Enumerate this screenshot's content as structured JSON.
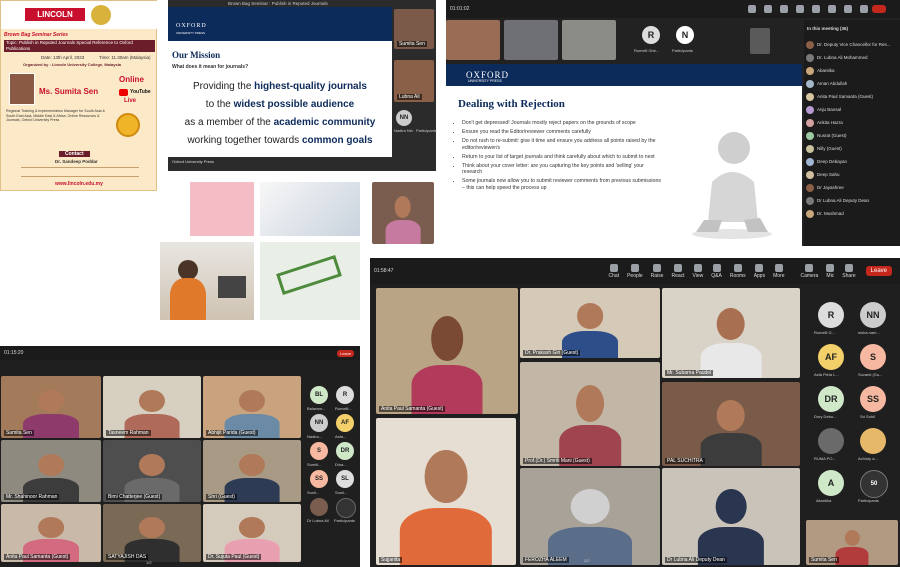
{
  "poster": {
    "logo": "LINCOLN",
    "series": "Brown Bag Seminar Series",
    "topic": "Topic: Publish in Reputed Journals Special Reference to Oxford Publications",
    "date": "Date: 13th April, 2023",
    "time": "Time: 11.30am (Malaysia)",
    "organiser": "Organized by : Lincoln University College, Malaysia",
    "mode": "Online",
    "speaker": "Ms. Sumita Sen",
    "bio": "Regional Training & Implementation Manager for South Asia & South East Asia, Middle East & Africa, Online Resources & Journals, Oxford University Press",
    "youtube": "YouTube",
    "live": "Live",
    "contact_title": "Contact",
    "contact_name": "Dr. Sandeep Poddar",
    "website": "www.lincoln.edu.my"
  },
  "slide_mission": {
    "window_title": "Brown Bag Seminar : Publish in Reputed Journals",
    "brand": "OXFORD",
    "brand_sub": "UNIVERSITY PRESS",
    "heading": "Our Mission",
    "sub": "What does it mean for journals?",
    "line1a": "Providing the ",
    "line1b": "highest-quality journals",
    "line2a": "to the ",
    "line2b": "widest possible audience",
    "line3a": "as a member of the ",
    "line3b": "academic community",
    "line4a": "working together towards ",
    "line4b": "common goals",
    "footer": "Oxford University Press",
    "side_user1": "Sumita Sen",
    "side_user2": "Lubna Ali",
    "nn": "NN",
    "nn_label": "Nadira Nin",
    "participants_label": "Participants"
  },
  "slide_rejection": {
    "time": "01:01:02",
    "brand": "OXFORD",
    "brand_sub": "UNIVERSITY PRESS",
    "heading": "Dealing with Rejection",
    "bullets": [
      "Don't get depressed! Journals mostly reject papers on the grounds of scope",
      "Ensure you read the Editor/reviewer comments carefully",
      "Do not rush to re-submit: give it time and ensure you address all points raised by the editor/reviewer/s",
      "Return to your list of target journals and think carefully about which to submit to next",
      "Think about your cover letter: are you capturing the key points and 'selling' your research",
      "Some journals now allow you to submit reviewer comments from previous submissions – this can help speed the process up"
    ],
    "avatar_r": "R",
    "avatar_r_label": "Rumelli Ghe...",
    "avatar_n": "N",
    "participants_label": "Participants",
    "panel_title": "In this meeting (36)",
    "panel_people": [
      "Dr. Deputy Vice Chancellor for Res...",
      "Dr. Lubna Ali Mohammed",
      "Abantika",
      "Aman Abdullah",
      "Anita Paul Samanta (Guest)",
      "Anju Bansal",
      "Ankita Hazra",
      "Nusrat (Guest)",
      "Nilly (Guest)",
      "Deep Debayan",
      "Deep Sahu",
      "Dr Jayashree",
      "Dr Lubna Ali Deputy Dean",
      "Dr. Mushmad"
    ]
  },
  "gallery_small": {
    "time": "01:15:20",
    "leave": "Leave",
    "tiles": [
      "Sumita Sen",
      "Tasneem Rahman",
      "Abhijit Parida (Guest)",
      "Mr. Shahinoor Rahman",
      "Bimi Chatterjee (Guest)",
      "Shri (Guest)",
      "Anita Paul Samanta (Guest)",
      "SATYAJISH DAS",
      "Dr. Sujuta Paul (Guest)"
    ],
    "avatars": [
      "BL",
      "R",
      "NN",
      "AF",
      "S",
      "DR",
      "SS",
      "SL"
    ],
    "avatar_labels": [
      "Balaram...",
      "Rumelli...",
      "Nadira...",
      "Asfa...",
      "Sumiti...",
      "Dina...",
      "Sunil...",
      "Sunil..."
    ],
    "lubna": "Dr Lubna Ali",
    "participants_label": "Participants",
    "page": "1/2"
  },
  "gallery_large": {
    "time": "01:58:47",
    "toolbar": [
      "Chat",
      "People",
      "Raise",
      "React",
      "View",
      "Q&A",
      "Rooms",
      "Apps",
      "More",
      "Camera",
      "Mic",
      "Share"
    ],
    "leave": "Leave",
    "tiles": [
      "Anita Paul Samanta (Guest)",
      "Dr. Prakash Giri (Guest)",
      "Mr. Subarna Paudel",
      "Prof.(Dr.) Smriti Mani (Guest)",
      "PAL SUCHITRA",
      "Sujjanita",
      "FEROZHA ALEEM",
      "Dr Lubna Ali Deputy Dean",
      "Sumita Sen"
    ],
    "avatars": [
      "R",
      "NN",
      "AF",
      "S",
      "DR",
      "SS",
      "",
      "",
      "A",
      "50"
    ],
    "avatar_labels": [
      "Rumelli G...",
      "nisha nam...",
      "Asfa Fitria L...",
      "Suvanti (Gu...",
      "Dory Debu...",
      "Sri Sohil",
      "RUMA PO...",
      "Achinty a...",
      "Akantika",
      "Participants"
    ],
    "page": "2/2"
  }
}
